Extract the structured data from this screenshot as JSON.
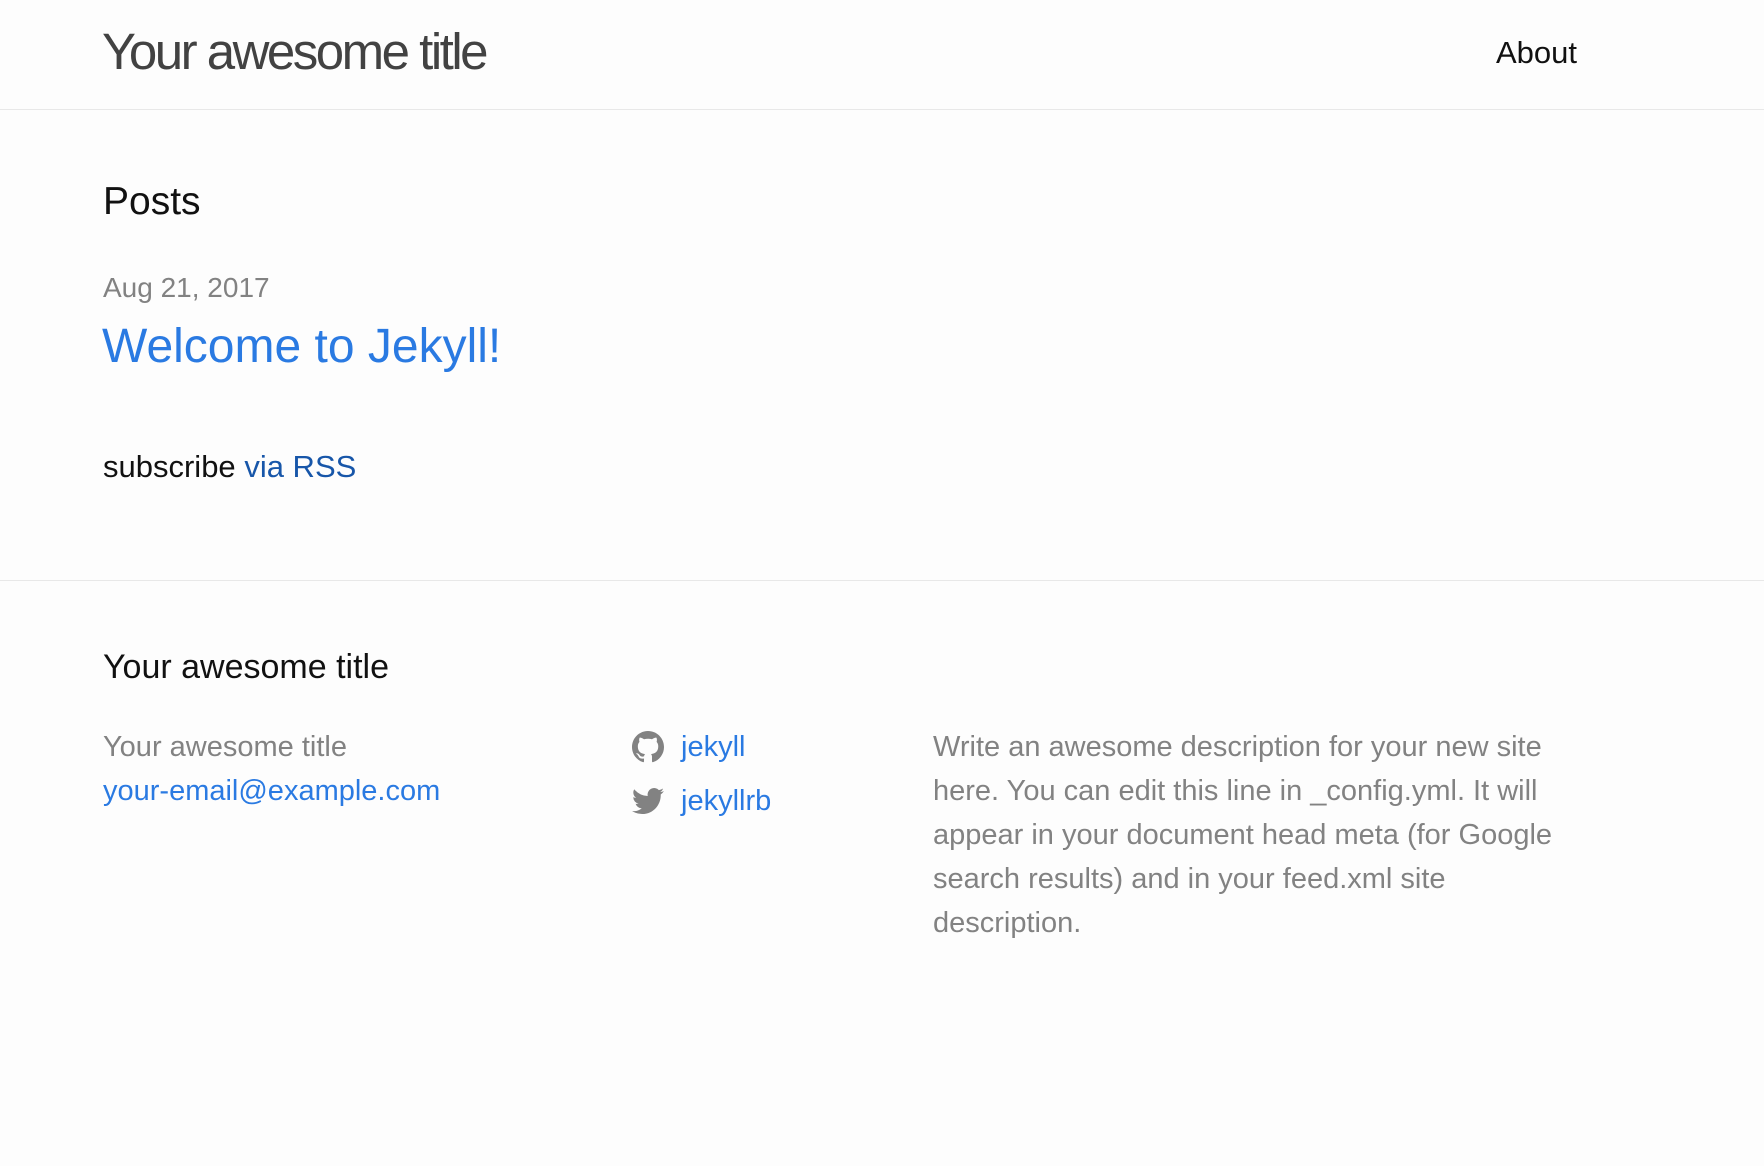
{
  "header": {
    "site_title": "Your awesome title",
    "nav": {
      "about_label": "About"
    }
  },
  "main": {
    "heading": "Posts",
    "posts": [
      {
        "date": "Aug 21, 2017",
        "title": "Welcome to Jekyll!"
      }
    ],
    "rss": {
      "prefix": "subscribe",
      "link_label": "via RSS"
    }
  },
  "footer": {
    "heading": "Your awesome title",
    "contact": {
      "name": "Your awesome title",
      "email": "your-email@example.com"
    },
    "social": [
      {
        "icon": "github-icon",
        "label": "jekyll"
      },
      {
        "icon": "twitter-icon",
        "label": "jekyllrb"
      }
    ],
    "description": "Write an awesome description for your new site here. You can edit this line in _config.yml. It will appear in your document head meta (for Google search results) and in your feed.xml site description."
  },
  "colors": {
    "link": "#2a7ae2",
    "rss_link": "#1756a9",
    "muted": "#828282",
    "text": "#111111",
    "border": "#e8e8e8",
    "background": "#fdfdfd"
  }
}
